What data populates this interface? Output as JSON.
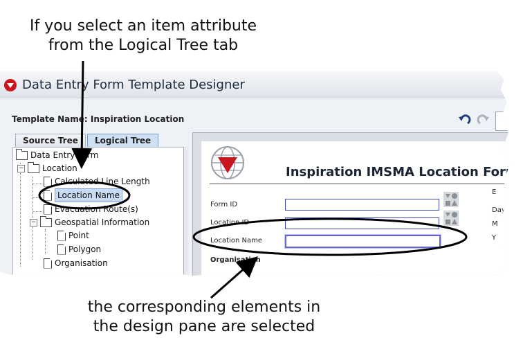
{
  "callouts": {
    "top_line1": "If you select an item attribute",
    "top_line2": "from the Logical Tree tab",
    "bottom_line1": "the corresponding elements in",
    "bottom_line2": "the design pane are selected"
  },
  "window": {
    "title": "Data Entry Form Template Designer",
    "template_name_label": "Template Name: Inspiration Location"
  },
  "tabs": {
    "source": "Source Tree",
    "logical": "Logical Tree"
  },
  "tree": {
    "root": "Data Entry Form",
    "location": "Location",
    "calc_line": "Calculated Line Length",
    "location_name": "Location Name",
    "evac_route": "Evacuation Route(s)",
    "geo_info": "Geospatial Information",
    "point": "Point",
    "polygon": "Polygon",
    "organisation": "Organisation"
  },
  "form": {
    "title": "Inspiration IMSMA Location Form",
    "form_id_label": "Form ID",
    "location_id_label": "Location ID",
    "location_name_label": "Location Name",
    "organisation_label": "Organisation",
    "right_labels": [
      "E",
      "Day",
      "M",
      "Y"
    ]
  },
  "colors": {
    "accent_red": "#c9151e",
    "field_border": "#3c4ab3",
    "selection": "#c8dbf2"
  }
}
